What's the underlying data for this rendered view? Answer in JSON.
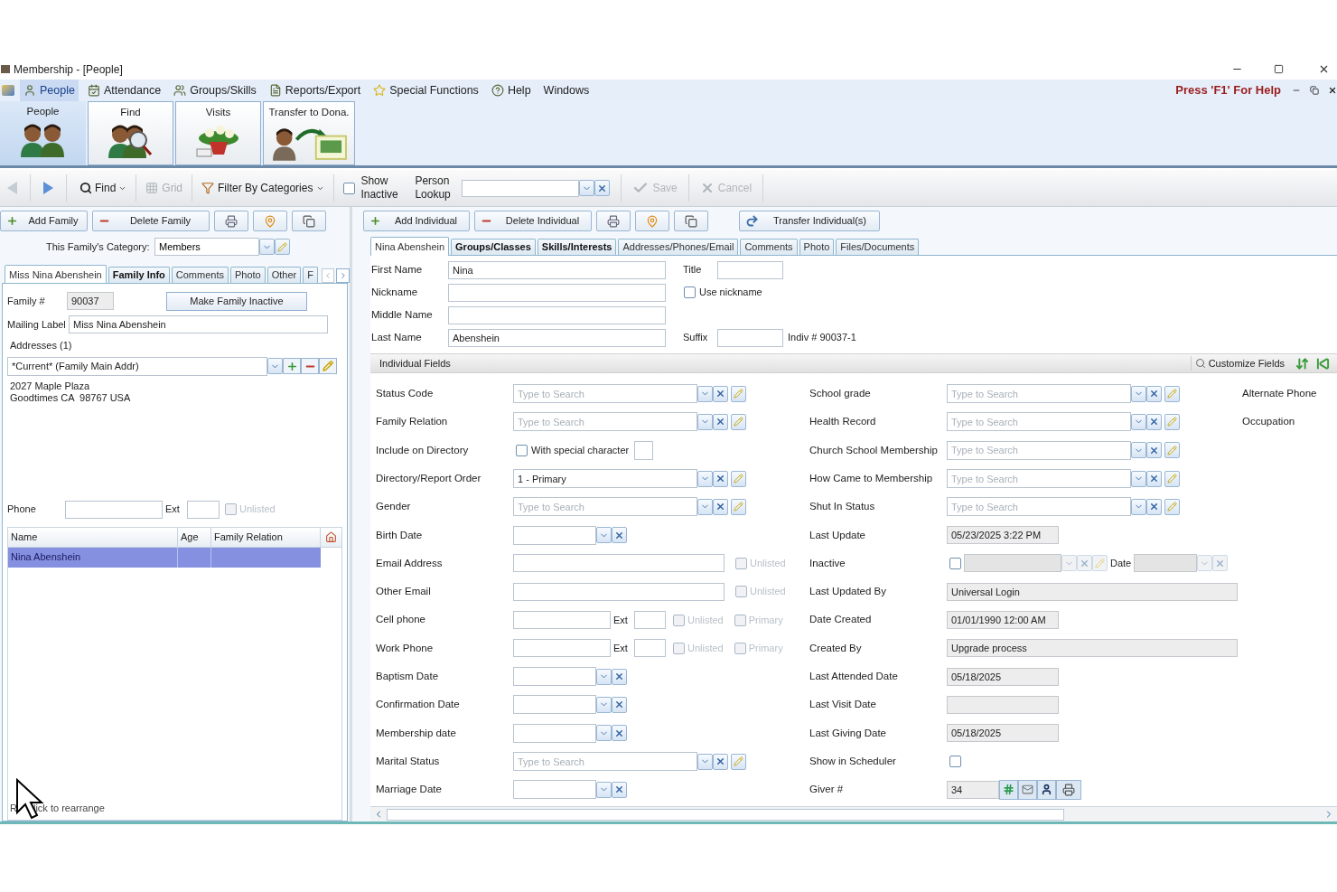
{
  "window": {
    "title": "Membership - [People]"
  },
  "menu": [
    {
      "label": "People",
      "selected": true
    },
    {
      "label": "Attendance",
      "selected": false
    },
    {
      "label": "Groups/Skills",
      "selected": false
    },
    {
      "label": "Reports/Export",
      "selected": false
    },
    {
      "label": "Special Functions",
      "selected": false
    },
    {
      "label": "Help",
      "selected": false
    },
    {
      "label": "Windows",
      "selected": false
    }
  ],
  "help_hint": "Press 'F1' For Help",
  "ribbon": [
    {
      "label": "People",
      "selected": true
    },
    {
      "label": "Find",
      "selected": false
    },
    {
      "label": "Visits",
      "selected": false
    },
    {
      "label": "Transfer to Dona.",
      "selected": false
    }
  ],
  "toolbar": {
    "find": "Find",
    "grid": "Grid",
    "filter": "Filter By Categories",
    "show_inactive": {
      "label": "Show Inactive",
      "checked": false
    },
    "person_lookup": "Person Lookup",
    "save": "Save",
    "cancel": "Cancel"
  },
  "family_panel": {
    "add": "Add Family",
    "delete": "Delete Family",
    "category_label": "This Family's Category:",
    "category": "Members",
    "tabs": [
      {
        "label": "Miss Nina Abenshein",
        "selected": true,
        "has_data": false
      },
      {
        "label": "Family Info",
        "selected": false,
        "has_data": true
      },
      {
        "label": "Comments",
        "selected": false,
        "has_data": false
      },
      {
        "label": "Photo",
        "selected": false,
        "has_data": false
      },
      {
        "label": "Other",
        "selected": false,
        "has_data": false
      },
      {
        "label": "F",
        "selected": false,
        "has_data": false
      }
    ],
    "family_no_label": "Family #",
    "family_no": "90037",
    "inactive_button": "Make Family Inactive",
    "mailing_label": "Mailing Label",
    "mailing": "Miss Nina Abenshein",
    "addresses_label": "Addresses (1)",
    "address": "*Current* (Family Main Addr)",
    "address_lines": [
      "2027 Maple Plaza",
      "Goodtimes CA  98767 USA"
    ],
    "phone_label": "Phone",
    "ext_label": "Ext",
    "unlisted": {
      "label": "Unlisted",
      "checked": false,
      "disabled": true
    },
    "table": {
      "columns": [
        "Name",
        "Age",
        "Family Relation"
      ],
      "rows": [
        {
          "name": "Nina Abenshein",
          "selected": true
        }
      ]
    },
    "footer": [
      "R",
      "lick to rearrange"
    ]
  },
  "individual_panel": {
    "add": "Add Individual",
    "delete": "Delete Individual",
    "transfer": "Transfer Individual(s)",
    "tabs": [
      {
        "label": "Nina Abenshein",
        "selected": true,
        "has_data": false
      },
      {
        "label": "Groups/Classes",
        "selected": false,
        "has_data": true
      },
      {
        "label": "Skills/Interests",
        "selected": false,
        "has_data": true
      },
      {
        "label": "Addresses/Phones/Email",
        "selected": false,
        "has_data": false
      },
      {
        "label": "Comments",
        "selected": false,
        "has_data": false
      },
      {
        "label": "Photo",
        "selected": false,
        "has_data": false
      },
      {
        "label": "Files/Documents",
        "selected": false,
        "has_data": false
      }
    ],
    "first_name_label": "First Name",
    "first_name": "Nina",
    "title_label": "Title",
    "nickname_label": "Nickname",
    "use_nickname": {
      "label": "Use nickname",
      "checked": false
    },
    "middle_name_label": "Middle Name",
    "last_name_label": "Last Name",
    "last_name": "Abenshein",
    "suffix_label": "Suffix",
    "indiv_no": "Indiv # 90037-1",
    "section_title": "Individual Fields",
    "customize": "Customize Fields",
    "left_fields": [
      {
        "kind": "combo",
        "label": "Status Code",
        "placeholder": "Type to Search"
      },
      {
        "kind": "combo",
        "label": "Family Relation",
        "placeholder": "Type to Search"
      },
      {
        "kind": "check",
        "label": "Include on Directory",
        "checked": false,
        "option": "With special character"
      },
      {
        "kind": "combo",
        "label": "Directory/Report Order",
        "value": "1 - Primary"
      },
      {
        "kind": "combo",
        "label": "Gender",
        "placeholder": "Type to Search"
      },
      {
        "kind": "date",
        "label": "Birth Date"
      },
      {
        "kind": "email",
        "label": "Email Address",
        "unlisted": {
          "label": "Unlisted",
          "checked": false,
          "disabled": true
        }
      },
      {
        "kind": "email",
        "label": "Other Email",
        "unlisted": {
          "label": "Unlisted",
          "checked": false,
          "disabled": true
        }
      },
      {
        "kind": "phone",
        "label": "Cell phone",
        "ext_label": "Ext",
        "unlisted": {
          "label": "Unlisted",
          "checked": false,
          "disabled": true
        },
        "primary": {
          "label": "Primary",
          "checked": false,
          "disabled": true
        }
      },
      {
        "kind": "phone",
        "label": "Work Phone",
        "ext_label": "Ext",
        "unlisted": {
          "label": "Unlisted",
          "checked": false,
          "disabled": true
        },
        "primary": {
          "label": "Primary",
          "checked": false,
          "disabled": true
        }
      },
      {
        "kind": "date",
        "label": "Baptism Date"
      },
      {
        "kind": "date",
        "label": "Confirmation Date"
      },
      {
        "kind": "date",
        "label": "Membership date"
      },
      {
        "kind": "combo",
        "label": "Marital Status",
        "placeholder": "Type to Search"
      },
      {
        "kind": "date",
        "label": "Marriage Date"
      }
    ],
    "right_fields": [
      {
        "kind": "combo",
        "label": "School grade",
        "placeholder": "Type to Search"
      },
      {
        "kind": "combo",
        "label": "Health Record",
        "placeholder": "Type to Search"
      },
      {
        "kind": "combo",
        "label": "Church School Membership",
        "placeholder": "Type to Search"
      },
      {
        "kind": "combo",
        "label": "How Came to Membership",
        "placeholder": "Type to Search"
      },
      {
        "kind": "combo",
        "label": "Shut In Status",
        "placeholder": "Type to Search"
      },
      {
        "kind": "stamp",
        "label": "Last Update",
        "value": "05/23/2025 3:22 PM"
      },
      {
        "kind": "inactive",
        "label": "Inactive",
        "checked": false,
        "date_label": "Date"
      },
      {
        "kind": "text",
        "label": "Last Updated By",
        "value": "Universal Login"
      },
      {
        "kind": "stamp",
        "label": "Date Created",
        "value": "01/01/1990 12:00 AM"
      },
      {
        "kind": "text",
        "label": "Created By",
        "value": "Upgrade process"
      },
      {
        "kind": "stamp",
        "label": "Last Attended Date",
        "value": "05/18/2025"
      },
      {
        "kind": "stamp",
        "label": "Last Visit Date"
      },
      {
        "kind": "stamp",
        "label": "Last Giving Date",
        "value": "05/18/2025"
      },
      {
        "kind": "checkbox",
        "label": "Show in Scheduler",
        "checked": false
      },
      {
        "kind": "giver",
        "label": "Giver #",
        "value": "34"
      }
    ],
    "extra_labels": [
      "Alternate Phone",
      "Occupation"
    ]
  }
}
